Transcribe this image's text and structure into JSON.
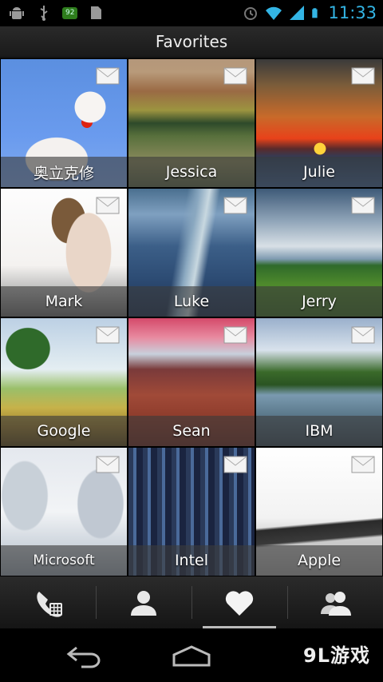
{
  "status_bar": {
    "left_icons": [
      "android-debug-icon",
      "usb-icon",
      "battery-saver-icon",
      "sd-card-icon"
    ],
    "battery_badge": "92",
    "right_icons": [
      "alarm-icon",
      "wifi-icon",
      "signal-icon",
      "battery-icon"
    ],
    "time": "11:33",
    "accent": "#33b5e5"
  },
  "action_bar": {
    "title": "Favorites"
  },
  "favorites": [
    {
      "name": "奥立克修"
    },
    {
      "name": "Jessica"
    },
    {
      "name": "Julie"
    },
    {
      "name": "Mark"
    },
    {
      "name": "Luke"
    },
    {
      "name": "Jerry"
    },
    {
      "name": "Google"
    },
    {
      "name": "Sean"
    },
    {
      "name": "IBM"
    },
    {
      "name": "Microsoft"
    },
    {
      "name": "Intel"
    },
    {
      "name": "Apple"
    }
  ],
  "tabs": [
    {
      "icon": "phone-dialpad-icon",
      "selected": false
    },
    {
      "icon": "contact-person-icon",
      "selected": false
    },
    {
      "icon": "heart-icon",
      "selected": true
    },
    {
      "icon": "group-people-icon",
      "selected": false
    }
  ],
  "nav_bar": {
    "buttons": [
      "back-icon",
      "home-icon"
    ]
  },
  "watermark": "9L游戏"
}
